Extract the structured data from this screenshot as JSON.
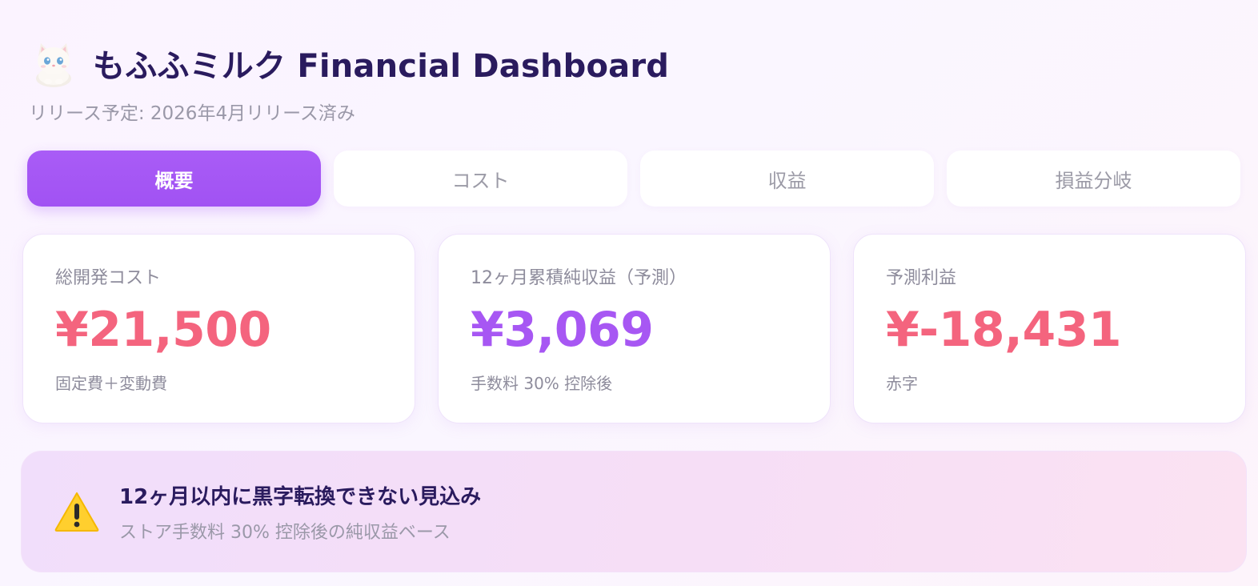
{
  "header": {
    "mascot_icon": "white-kitten-icon",
    "title": "もふふミルク Financial Dashboard",
    "subtitle": "リリース予定: 2026年4月リリース済み"
  },
  "tabs": [
    {
      "label": "概要",
      "active": true
    },
    {
      "label": "コスト",
      "active": false
    },
    {
      "label": "収益",
      "active": false
    },
    {
      "label": "損益分岐",
      "active": false
    }
  ],
  "cards": [
    {
      "label": "総開発コスト",
      "value": "¥21,500",
      "note": "固定費＋変動費",
      "color": "#f4647e"
    },
    {
      "label": "12ヶ月累積純収益（予測）",
      "value": "¥3,069",
      "note": "手数料 30% 控除後",
      "color": "#a757f3"
    },
    {
      "label": "予測利益",
      "value": "¥-18,431",
      "note": "赤字",
      "color": "#f4647e"
    }
  ],
  "alert": {
    "icon": "warning-icon",
    "title": "12ヶ月以内に黒字転換できない見込み",
    "subtitle": "ストア手数料 30% 控除後の純収益ベース"
  },
  "colors": {
    "accent": "#a757f3",
    "negative": "#f4647e",
    "text_dark": "#2a1b5e",
    "text_muted": "#9a98a8"
  }
}
